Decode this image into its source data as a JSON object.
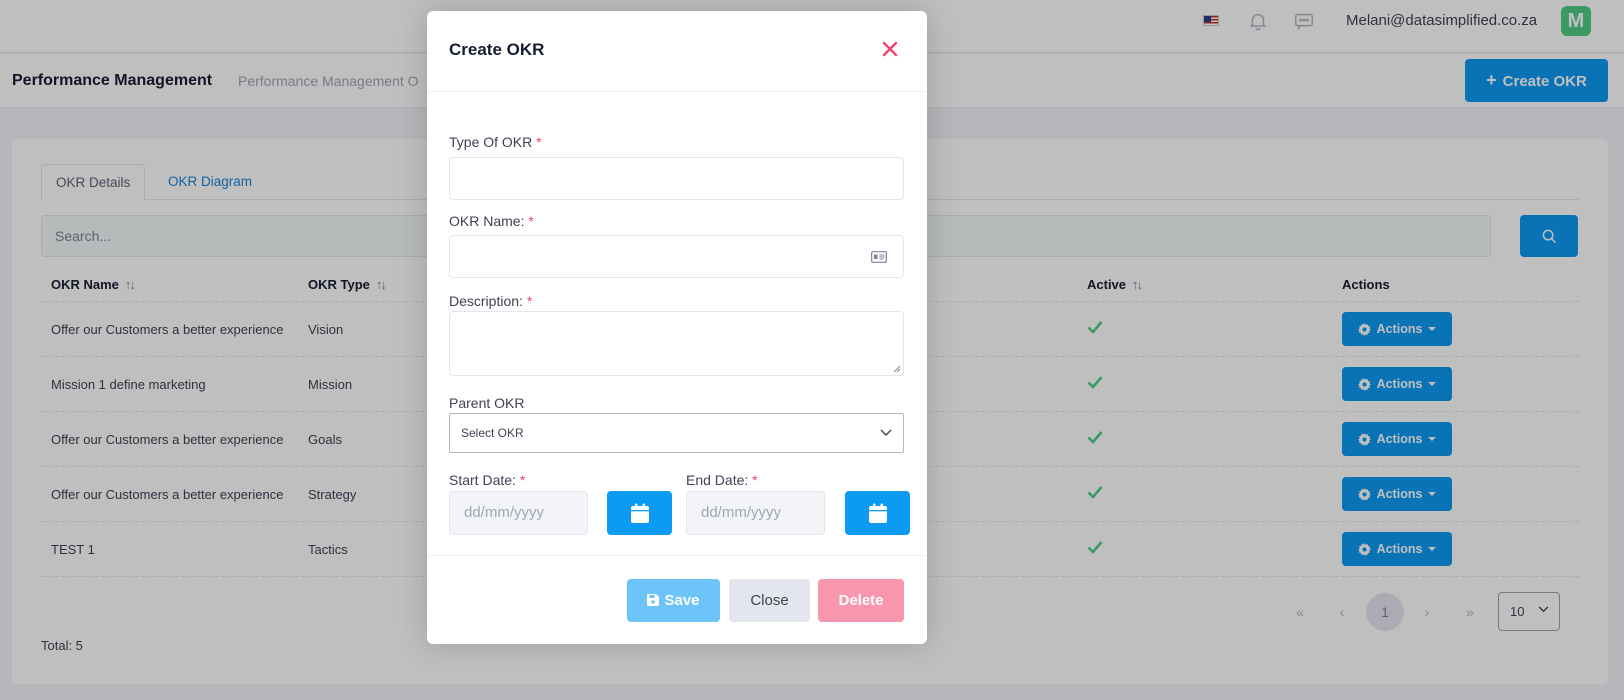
{
  "topbar": {
    "icons": [
      "us-flag-icon",
      "bell-icon",
      "message-icon"
    ],
    "user_email": "Melani@datasimplified.co.za",
    "avatar_letter": "M"
  },
  "header": {
    "title": "Performance Management",
    "breadcrumb": "Performance Management O",
    "create_button": "Create OKR"
  },
  "tabs": [
    {
      "label": "OKR Details",
      "active": true
    },
    {
      "label": "OKR Diagram",
      "active": false
    }
  ],
  "search": {
    "placeholder": "Search..."
  },
  "table": {
    "columns": [
      "OKR Name",
      "OKR Type",
      "Active",
      "Actions"
    ],
    "rows": [
      {
        "name": "Offer our Customers a better experience",
        "type": "Vision",
        "active": true,
        "action": "Actions"
      },
      {
        "name": "Mission 1 define marketing",
        "type": "Mission",
        "active": true,
        "action": "Actions"
      },
      {
        "name": "Offer our Customers a better experience",
        "type": "Goals",
        "active": true,
        "action": "Actions"
      },
      {
        "name": "Offer our Customers a better experience",
        "type": "Strategy",
        "active": true,
        "action": "Actions"
      },
      {
        "name": "TEST 1",
        "type": "Tactics",
        "active": true,
        "action": "Actions"
      }
    ]
  },
  "pagination": {
    "first": "«",
    "prev": "‹",
    "current_page": "1",
    "next": "›",
    "last": "»",
    "page_size": "10"
  },
  "total": "Total: 5",
  "modal": {
    "title": "Create OKR",
    "fields": {
      "type_label": "Type Of OKR",
      "name_label": "OKR Name:",
      "description_label": "Description:",
      "parent_label": "Parent OKR",
      "parent_selected": "Select OKR",
      "start_label": "Start Date:",
      "end_label": "End Date:",
      "date_placeholder": "dd/mm/yyyy",
      "required_mark": "*"
    },
    "buttons": {
      "save": "Save",
      "close": "Close",
      "delete": "Delete"
    }
  },
  "colors": {
    "primary": "#0d9af2",
    "save_disabled": "#6cc4f8",
    "delete_disabled": "#f896ad",
    "success": "#50cd89",
    "danger": "#f1416c"
  }
}
